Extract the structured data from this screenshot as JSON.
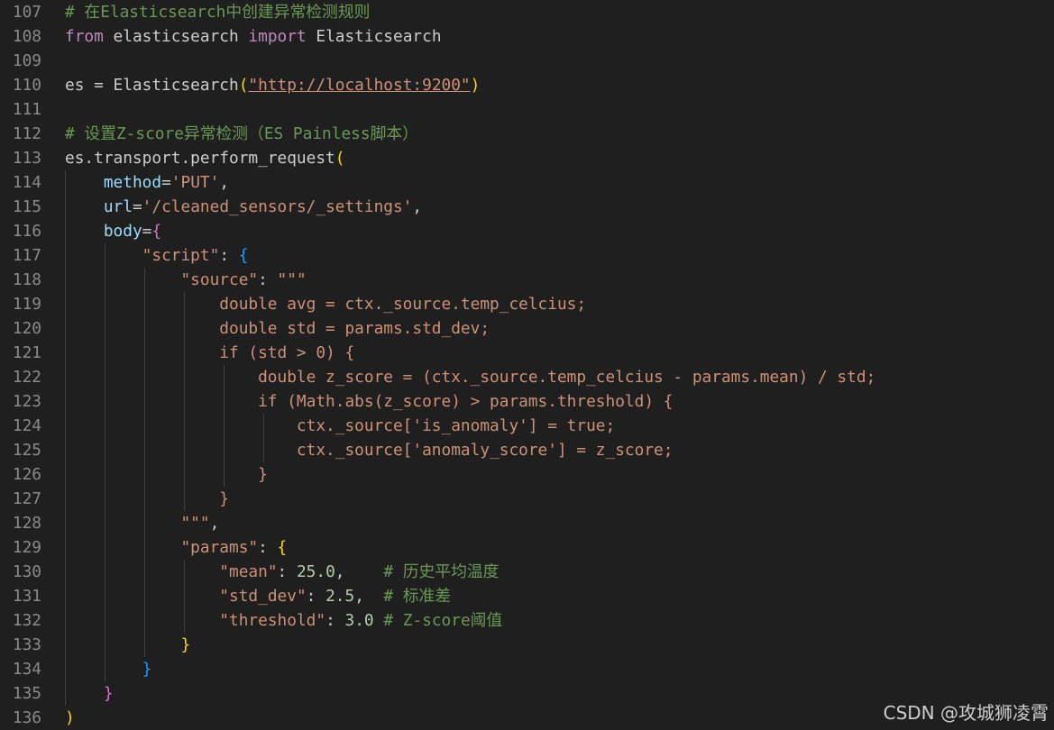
{
  "editor": {
    "language": "python",
    "lines": [
      {
        "no": "107",
        "tokens": [
          {
            "t": "# 在Elasticsearch中创建异常检测规则",
            "c": "cm"
          }
        ],
        "indent": 0
      },
      {
        "no": "108",
        "tokens": [
          {
            "t": "from",
            "c": "kw"
          },
          {
            "t": " elasticsearch ",
            "c": ""
          },
          {
            "t": "import",
            "c": "kw"
          },
          {
            "t": " Elasticsearch",
            "c": ""
          }
        ],
        "indent": 0
      },
      {
        "no": "109",
        "tokens": [],
        "indent": 0
      },
      {
        "no": "110",
        "tokens": [
          {
            "t": "es = Elasticsearch",
            "c": ""
          },
          {
            "t": "(",
            "c": "bkt1"
          },
          {
            "t": "\"http://localhost:9200\"",
            "c": "str link"
          },
          {
            "t": ")",
            "c": "bkt1"
          }
        ],
        "indent": 0
      },
      {
        "no": "111",
        "tokens": [],
        "indent": 0
      },
      {
        "no": "112",
        "tokens": [
          {
            "t": "# 设置Z-score异常检测（ES Painless脚本）",
            "c": "cm"
          }
        ],
        "indent": 0
      },
      {
        "no": "113",
        "tokens": [
          {
            "t": "es.transport.perform_request",
            "c": ""
          },
          {
            "t": "(",
            "c": "bkt1"
          }
        ],
        "indent": 0
      },
      {
        "no": "114",
        "tokens": [
          {
            "t": "    ",
            "c": ""
          },
          {
            "t": "method",
            "c": "prm"
          },
          {
            "t": "=",
            "c": ""
          },
          {
            "t": "'PUT'",
            "c": "str"
          },
          {
            "t": ",",
            "c": ""
          }
        ],
        "indent": 1
      },
      {
        "no": "115",
        "tokens": [
          {
            "t": "    ",
            "c": ""
          },
          {
            "t": "url",
            "c": "prm"
          },
          {
            "t": "=",
            "c": ""
          },
          {
            "t": "'/cleaned_sensors/_settings'",
            "c": "str"
          },
          {
            "t": ",",
            "c": ""
          }
        ],
        "indent": 1
      },
      {
        "no": "116",
        "tokens": [
          {
            "t": "    ",
            "c": ""
          },
          {
            "t": "body",
            "c": "prm"
          },
          {
            "t": "=",
            "c": ""
          },
          {
            "t": "{",
            "c": "bkt2"
          }
        ],
        "indent": 1
      },
      {
        "no": "117",
        "tokens": [
          {
            "t": "        ",
            "c": ""
          },
          {
            "t": "\"script\"",
            "c": "key"
          },
          {
            "t": ": ",
            "c": ""
          },
          {
            "t": "{",
            "c": "bkt3"
          }
        ],
        "indent": 2
      },
      {
        "no": "118",
        "tokens": [
          {
            "t": "            ",
            "c": ""
          },
          {
            "t": "\"source\"",
            "c": "key"
          },
          {
            "t": ": ",
            "c": ""
          },
          {
            "t": "\"\"\"",
            "c": "str"
          }
        ],
        "indent": 3
      },
      {
        "no": "119",
        "tokens": [
          {
            "t": "                double avg = ctx._source.temp_celcius;",
            "c": "str"
          }
        ],
        "indent": 4
      },
      {
        "no": "120",
        "tokens": [
          {
            "t": "                double std = params.std_dev;",
            "c": "str"
          }
        ],
        "indent": 4
      },
      {
        "no": "121",
        "tokens": [
          {
            "t": "                if (std > 0) {",
            "c": "str"
          }
        ],
        "indent": 4
      },
      {
        "no": "122",
        "tokens": [
          {
            "t": "                    double z_score = (ctx._source.temp_celcius - params.mean) / std;",
            "c": "str"
          }
        ],
        "indent": 5
      },
      {
        "no": "123",
        "tokens": [
          {
            "t": "                    if (Math.abs(z_score) > params.threshold) {",
            "c": "str"
          }
        ],
        "indent": 5
      },
      {
        "no": "124",
        "tokens": [
          {
            "t": "                        ctx._source['is_anomaly'] = true;",
            "c": "str"
          }
        ],
        "indent": 6
      },
      {
        "no": "125",
        "tokens": [
          {
            "t": "                        ctx._source['anomaly_score'] = z_score;",
            "c": "str"
          }
        ],
        "indent": 6
      },
      {
        "no": "126",
        "tokens": [
          {
            "t": "                    }",
            "c": "str"
          }
        ],
        "indent": 5
      },
      {
        "no": "127",
        "tokens": [
          {
            "t": "                }",
            "c": "str"
          }
        ],
        "indent": 4
      },
      {
        "no": "128",
        "tokens": [
          {
            "t": "            ",
            "c": ""
          },
          {
            "t": "\"\"\"",
            "c": "str"
          },
          {
            "t": ",",
            "c": ""
          }
        ],
        "indent": 3
      },
      {
        "no": "129",
        "tokens": [
          {
            "t": "            ",
            "c": ""
          },
          {
            "t": "\"params\"",
            "c": "key"
          },
          {
            "t": ": ",
            "c": ""
          },
          {
            "t": "{",
            "c": "bkt1"
          }
        ],
        "indent": 3
      },
      {
        "no": "130",
        "tokens": [
          {
            "t": "                ",
            "c": ""
          },
          {
            "t": "\"mean\"",
            "c": "key"
          },
          {
            "t": ": ",
            "c": ""
          },
          {
            "t": "25.0",
            "c": "num"
          },
          {
            "t": ",    ",
            "c": ""
          },
          {
            "t": "# 历史平均温度",
            "c": "cm"
          }
        ],
        "indent": 4
      },
      {
        "no": "131",
        "tokens": [
          {
            "t": "                ",
            "c": ""
          },
          {
            "t": "\"std_dev\"",
            "c": "key"
          },
          {
            "t": ": ",
            "c": ""
          },
          {
            "t": "2.5",
            "c": "num"
          },
          {
            "t": ",  ",
            "c": ""
          },
          {
            "t": "# 标准差",
            "c": "cm"
          }
        ],
        "indent": 4
      },
      {
        "no": "132",
        "tokens": [
          {
            "t": "                ",
            "c": ""
          },
          {
            "t": "\"threshold\"",
            "c": "key"
          },
          {
            "t": ": ",
            "c": ""
          },
          {
            "t": "3.0",
            "c": "num"
          },
          {
            "t": " ",
            "c": ""
          },
          {
            "t": "# Z-score阈值",
            "c": "cm"
          }
        ],
        "indent": 4
      },
      {
        "no": "133",
        "tokens": [
          {
            "t": "            ",
            "c": ""
          },
          {
            "t": "}",
            "c": "bkt1"
          }
        ],
        "indent": 3
      },
      {
        "no": "134",
        "tokens": [
          {
            "t": "        ",
            "c": ""
          },
          {
            "t": "}",
            "c": "bkt3"
          }
        ],
        "indent": 2
      },
      {
        "no": "135",
        "tokens": [
          {
            "t": "    ",
            "c": ""
          },
          {
            "t": "}",
            "c": "bkt2"
          }
        ],
        "indent": 1
      },
      {
        "no": "136",
        "tokens": [
          {
            "t": ")",
            "c": "bkt1"
          }
        ],
        "indent": 0
      }
    ]
  },
  "watermark": "CSDN @攻城狮凌霄",
  "colors": {
    "background": "#1f1f1f",
    "line_number": "#8a8a8a",
    "keyword": "#c586c0",
    "string": "#ce9178",
    "comment": "#6a9955",
    "number": "#b5cea8",
    "parameter": "#9cdcfe",
    "bracket_gold": "#ffd700",
    "bracket_pink": "#da70d6",
    "bracket_blue": "#179fff"
  }
}
